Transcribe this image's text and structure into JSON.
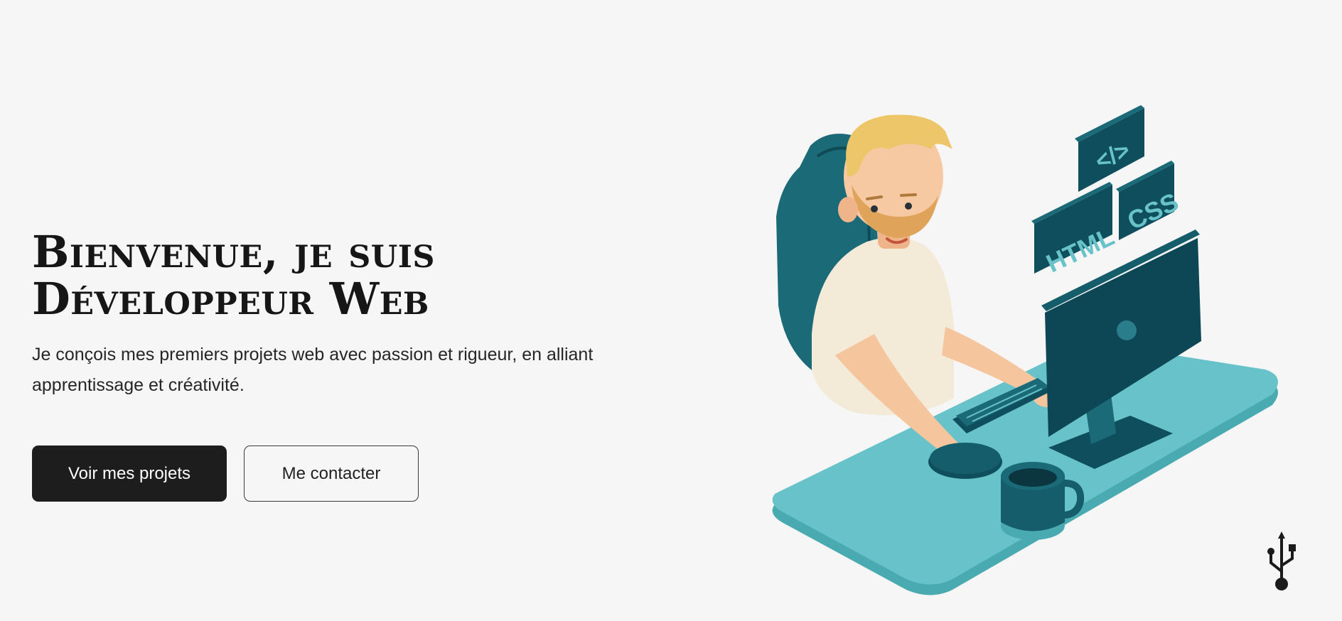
{
  "hero": {
    "title_line1": "Bienvenue, je suis",
    "title_line2": "Développeur Web",
    "subtitle": "Je conçois mes premiers projets web avec passion et rigueur, en alliant apprentissage et créativité.",
    "primary_button": "Voir mes projets",
    "secondary_button": "Me contacter"
  },
  "illustration": {
    "badge_code": "</>",
    "badge_css": "CSS",
    "badge_html": "HTML"
  },
  "icons": {
    "floating": "usb-icon"
  },
  "colors": {
    "background": "#f6f6f6",
    "primary_button": "#1d1d1d",
    "desk": "#63c0c6",
    "dark_teal": "#155d6b"
  }
}
